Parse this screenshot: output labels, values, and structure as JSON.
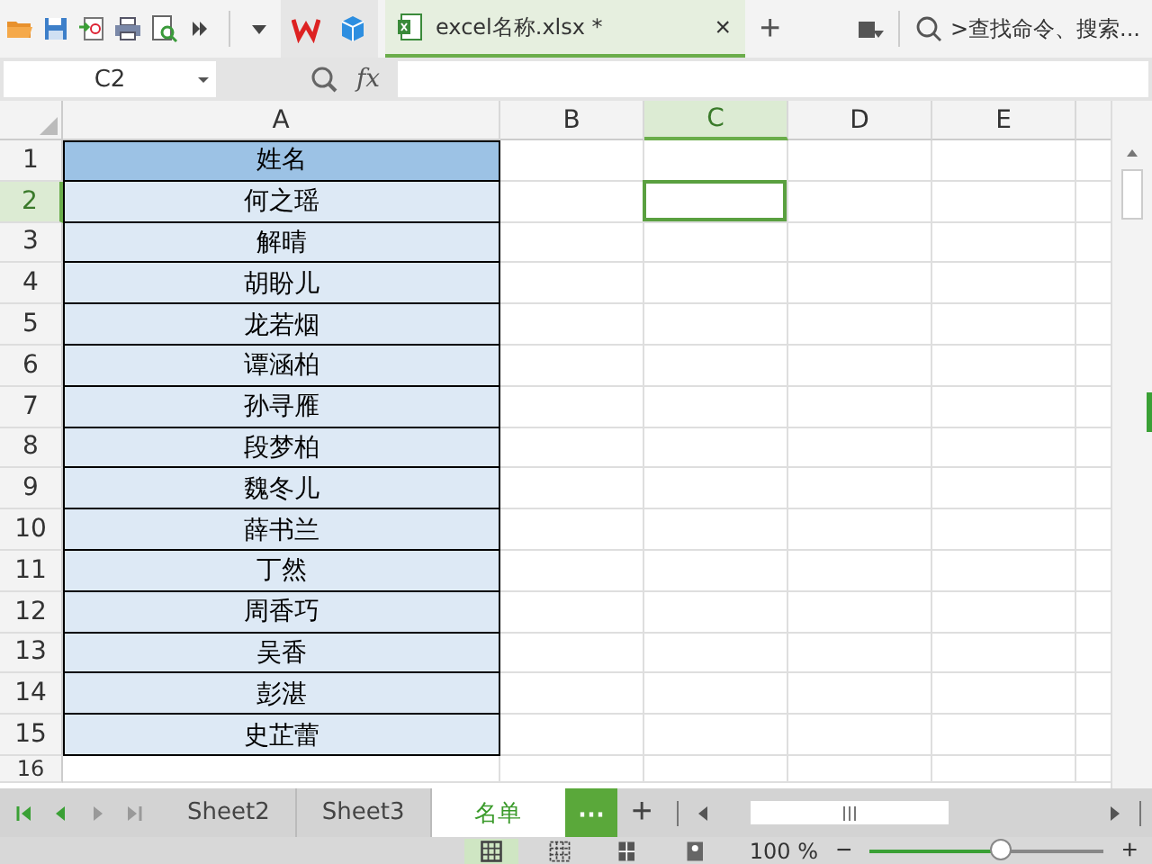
{
  "toolbar": {
    "document_tab": {
      "title": "excel名称.xlsx *",
      "close": "×",
      "selected": true
    },
    "new_tab": "+",
    "search": {
      "placeholder": ">查找命令、搜索..."
    }
  },
  "formula_bar": {
    "name_box": "C2",
    "function_label": "fx"
  },
  "columns": [
    {
      "label": "A",
      "selected": false
    },
    {
      "label": "B",
      "selected": false
    },
    {
      "label": "C",
      "selected": true
    },
    {
      "label": "D",
      "selected": false
    },
    {
      "label": "E",
      "selected": false
    }
  ],
  "rows": [
    {
      "number": "1",
      "selected": false,
      "name": "姓名",
      "kind": "header"
    },
    {
      "number": "2",
      "selected": true,
      "name": "何之瑶",
      "kind": "data"
    },
    {
      "number": "3",
      "selected": false,
      "name": "解晴",
      "kind": "data"
    },
    {
      "number": "4",
      "selected": false,
      "name": "胡盼儿",
      "kind": "data"
    },
    {
      "number": "5",
      "selected": false,
      "name": "龙若烟",
      "kind": "data"
    },
    {
      "number": "6",
      "selected": false,
      "name": "谭涵柏",
      "kind": "data"
    },
    {
      "number": "7",
      "selected": false,
      "name": "孙寻雁",
      "kind": "data"
    },
    {
      "number": "8",
      "selected": false,
      "name": "段梦柏",
      "kind": "data"
    },
    {
      "number": "9",
      "selected": false,
      "name": "魏冬儿",
      "kind": "data"
    },
    {
      "number": "10",
      "selected": false,
      "name": "薛书兰",
      "kind": "data"
    },
    {
      "number": "11",
      "selected": false,
      "name": "丁然",
      "kind": "data"
    },
    {
      "number": "12",
      "selected": false,
      "name": "周香巧",
      "kind": "data"
    },
    {
      "number": "13",
      "selected": false,
      "name": "吴香",
      "kind": "data"
    },
    {
      "number": "14",
      "selected": false,
      "name": "彭湛",
      "kind": "data"
    },
    {
      "number": "15",
      "selected": false,
      "name": "史芷蕾",
      "kind": "data"
    },
    {
      "number": "16",
      "selected": false,
      "kind": "empty"
    }
  ],
  "sheet_tabs": [
    {
      "label": "Sheet2",
      "selected": false
    },
    {
      "label": "Sheet3",
      "selected": false
    },
    {
      "label": "名单",
      "selected": true
    }
  ],
  "more_sheets": "⋯",
  "add_sheet": "+",
  "status_bar": {
    "zoom": "100 %",
    "zoom_out": "−",
    "zoom_in": "+",
    "zoom_slider": {
      "level": 0.57
    }
  }
}
